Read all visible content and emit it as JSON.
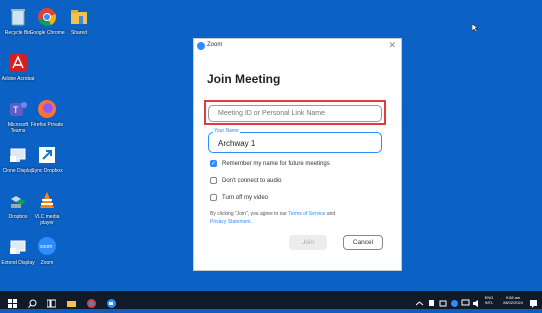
{
  "desktop": {
    "icons": [
      {
        "label": "Recycle Bin",
        "icon": "recycle-bin-icon"
      },
      {
        "label": "Google Chrome",
        "icon": "chrome-icon"
      },
      {
        "label": "Shared",
        "icon": "folder-icon"
      },
      {
        "label": "Adobe Acrobat",
        "icon": "acrobat-icon"
      },
      {
        "label": "Microsoft Teams",
        "icon": "teams-icon"
      },
      {
        "label": "Firefox Private",
        "icon": "firefox-icon"
      },
      {
        "label": "Clone Display",
        "icon": "display-icon"
      },
      {
        "label": "Sync Dropbox",
        "icon": "shortcut-icon"
      },
      {
        "label": "Dropbox",
        "icon": "dropbox-icon"
      },
      {
        "label": "VLC media player",
        "icon": "vlc-icon"
      },
      {
        "label": "Extend Display",
        "icon": "display-icon"
      },
      {
        "label": "Zoom",
        "icon": "zoom-icon"
      }
    ]
  },
  "window": {
    "title": "Zoom",
    "close": "✕",
    "heading": "Join Meeting",
    "meeting_id_placeholder": "Meeting ID or Personal Link Name",
    "name_label": "Your Name",
    "name_value": "Archway 1",
    "options": [
      {
        "label": "Remember my name for future meetings",
        "checked": true
      },
      {
        "label": "Don't connect to audio",
        "checked": false
      },
      {
        "label": "Turn off my video",
        "checked": false
      }
    ],
    "terms_prefix": "By clicking \"Join\", you agree to our ",
    "terms_link": "Terms of Service",
    "terms_and": " and",
    "privacy_link": "Privacy Statement",
    "terms_suffix": ".",
    "join_label": "Join",
    "cancel_label": "Cancel",
    "accent": "#2d8cff",
    "highlight_color": "#e23b3b"
  },
  "taskbar": {
    "lang_top": "ENG",
    "lang_bottom": "INTL",
    "time": "9:58 am",
    "date": "28/02/2024"
  }
}
